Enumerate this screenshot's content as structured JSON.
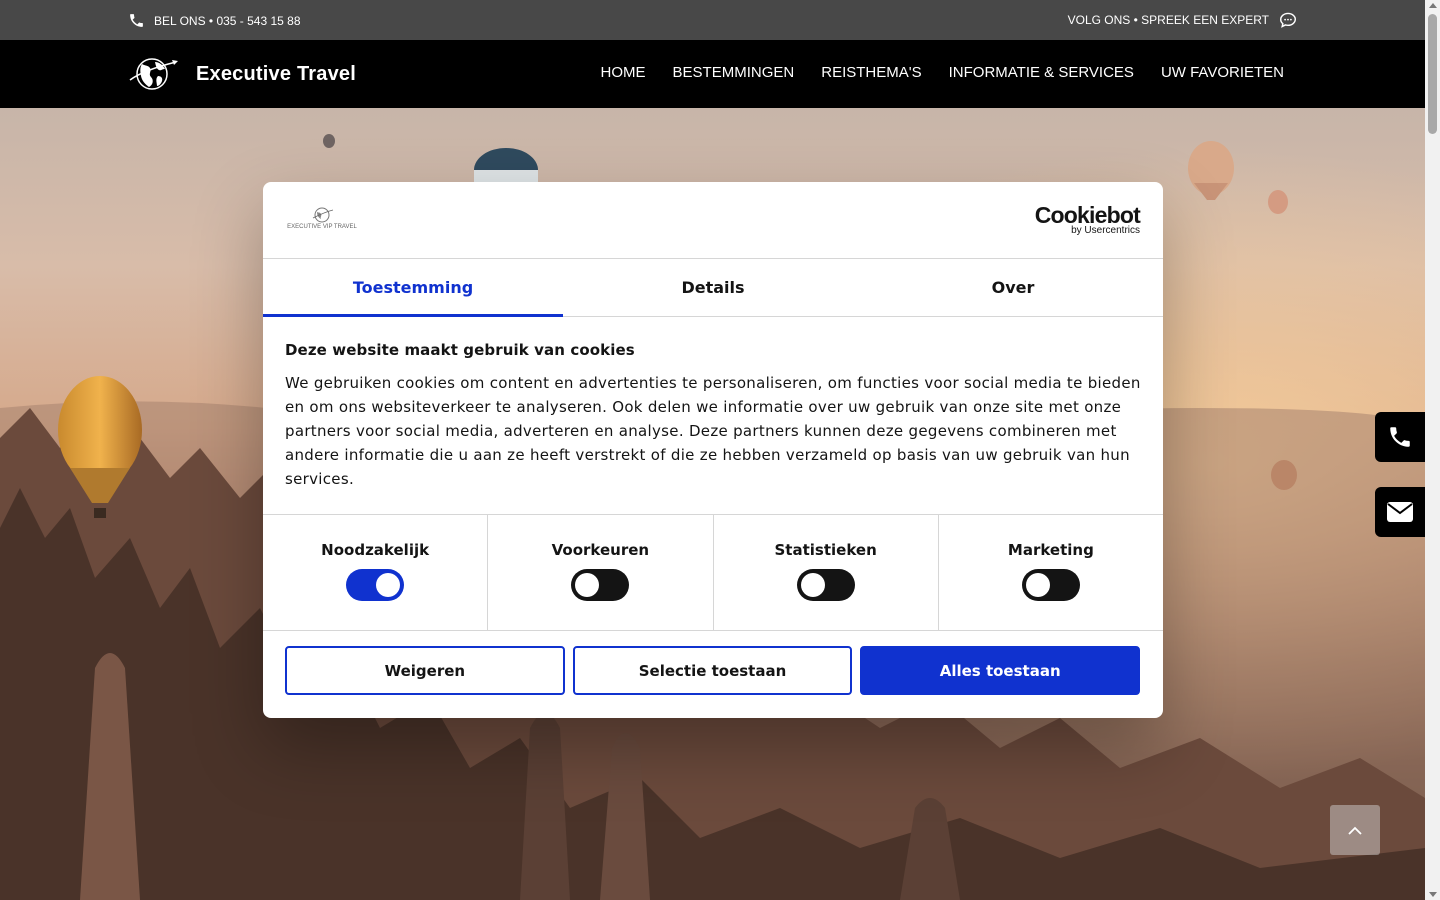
{
  "topbar": {
    "phone_text": "BEL ONS • 035 - 543 15 88",
    "follow_text": "VOLG ONS • SPREEK EEN EXPERT"
  },
  "nav": {
    "brand": "Executive Travel",
    "items": [
      "HOME",
      "BESTEMMINGEN",
      "REISTHEMA'S",
      "INFORMATIE & SERVICES",
      "UW FAVORIETEN"
    ]
  },
  "cookie": {
    "logo_word": "Cookiebot",
    "logo_sub": "by Usercentrics",
    "site_logo_text": "EXECUTIVE VIP TRAVEL",
    "tabs": [
      "Toestemming",
      "Details",
      "Over"
    ],
    "active_tab": "Toestemming",
    "title": "Deze website maakt gebruik van cookies",
    "description": "We gebruiken cookies om content en advertenties te personaliseren, om functies voor social media te bieden en om ons websiteverkeer te analyseren. Ook delen we informatie over uw gebruik van onze site met onze partners voor social media, adverteren en analyse. Deze partners kunnen deze gegevens combineren met andere informatie die u aan ze heeft verstrekt of die ze hebben verzameld op basis van uw gebruik van hun services.",
    "categories": [
      {
        "label": "Noodzakelijk",
        "enabled": true
      },
      {
        "label": "Voorkeuren",
        "enabled": false
      },
      {
        "label": "Statistieken",
        "enabled": false
      },
      {
        "label": "Marketing",
        "enabled": false
      }
    ],
    "buttons": {
      "decline": "Weigeren",
      "selection": "Selectie toestaan",
      "accept_all": "Alles toestaan"
    }
  },
  "colors": {
    "accent": "#1032cf",
    "topbar": "#484848",
    "navbar": "#000000"
  },
  "icons": {
    "topbar_left": "phone-icon",
    "topbar_right": "chat-bubble-icon",
    "side_1": "phone-icon",
    "side_2": "envelope-icon",
    "scroll_top": "chevron-up-icon"
  }
}
